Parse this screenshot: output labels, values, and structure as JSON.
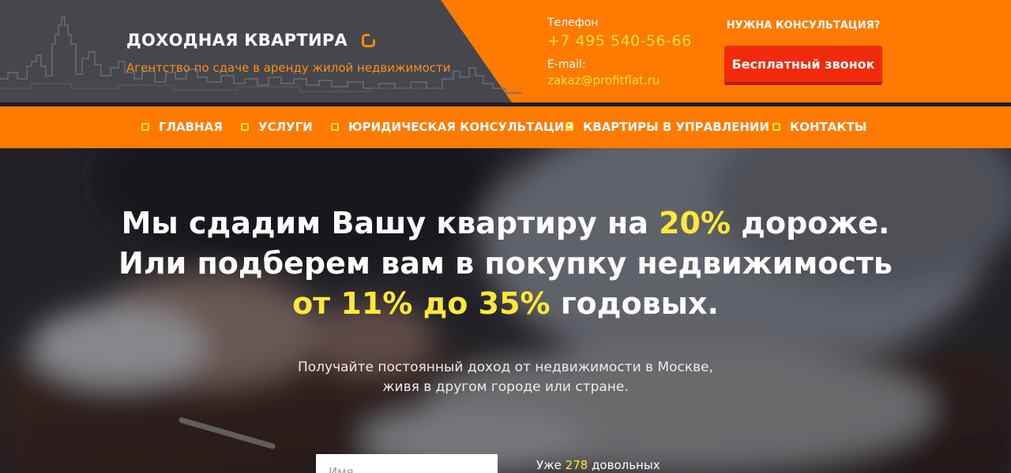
{
  "brand": {
    "title": "ДОХОДНАЯ КВАРТИРА",
    "subtitle": "Агентство по сдаче в аренду жилой недвижимости"
  },
  "contacts": {
    "phone_label": "Телефон",
    "phone": "+7 495 540-56-66",
    "email_label": "E-mail:",
    "email": "zakaz@profitflat.ru"
  },
  "consult": {
    "label": "НУЖНА КОНСУЛЬТАЦИЯ?",
    "button": "Бесплатный звонок"
  },
  "nav": [
    {
      "label": "ГЛАВНАЯ"
    },
    {
      "label": "УСЛУГИ"
    },
    {
      "label": "ЮРИДИЧЕСКАЯ КОНСУЛЬТАЦИЯ"
    },
    {
      "label": "КВАРТИРЫ В УПРАВЛЕНИИ"
    },
    {
      "label": "КОНТАКТЫ"
    }
  ],
  "hero": {
    "line1_a": "Мы сдадим Вашу квартиру на ",
    "line1_hl": "20%",
    "line1_b": " дороже.",
    "line2": "Или подберем вам в покупку недвижимость",
    "line3_hl": "от 11% до 35%",
    "line3_b": " годовых.",
    "sub1": "Получайте постоянный доход от недвижимости в Москве,",
    "sub2": "живя в другом городе или стране."
  },
  "form": {
    "name_placeholder": "Имя"
  },
  "clients": {
    "prefix": "Уже ",
    "count": "278",
    "suffix": " довольных"
  },
  "colors": {
    "accent_orange": "#ff7a00",
    "header_dark": "#45474d",
    "highlight_yellow": "#ffe83a",
    "button_red": "#f12a0b"
  }
}
